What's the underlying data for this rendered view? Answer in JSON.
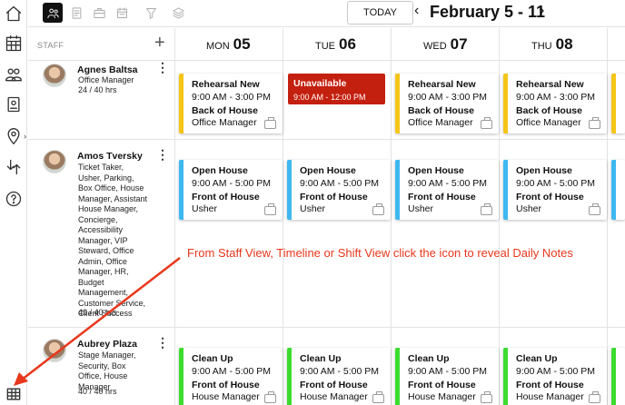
{
  "header": {
    "today_label": "TODAY",
    "date_range": "February 5 - 11",
    "prev_arrow": "‹",
    "next_arrow": "›"
  },
  "grid": {
    "staff_label": "STAFF",
    "add_label": "+",
    "days": [
      {
        "dow": "MON",
        "num": "05"
      },
      {
        "dow": "TUE",
        "num": "06"
      },
      {
        "dow": "WED",
        "num": "07"
      },
      {
        "dow": "THU",
        "num": "08"
      }
    ]
  },
  "staff": [
    {
      "name": "Agnes Baltsa",
      "role": "Office Manager",
      "hours": "24 / 40 hrs"
    },
    {
      "name": "Amos Tversky",
      "role": "Ticket Taker, Usher, Parking, Box Office, House Manager, Assistant House Manager, Concierge, Accessibility Manager, VIP Steward, Office Admin, Office Manager, HR, Budget Management, Customer Service, Client Success",
      "hours": "40 / 40 hrs"
    },
    {
      "name": "Aubrey Plaza",
      "role": "Stage Manager, Security, Box Office, House Manager",
      "hours": "40 / 40 hrs"
    }
  ],
  "shifts": {
    "row1": {
      "title": "Rehearsal New",
      "time": "9:00 AM - 3:00 PM",
      "dept": "Back of House",
      "position": "Office Manager",
      "color": "#f5c518"
    },
    "row1_unavailable": {
      "title": "Unavailable",
      "time": "9:00 AM - 12:00 PM",
      "color": "#c4200f"
    },
    "row2": {
      "title": "Open House",
      "time": "9:00 AM - 5:00 PM",
      "dept": "Front of House",
      "position": "Usher",
      "color": "#3fb8f0"
    },
    "row3": {
      "title": "Clean Up",
      "time": "9:00 AM - 5:00 PM",
      "dept": "Front of House",
      "position": "House Manager",
      "color": "#3ddc2f"
    }
  },
  "annotation": {
    "text": "From Staff View, Timeline or Shift View click the icon to reveal Daily Notes",
    "color": "#e8371c"
  },
  "icons": {
    "rail": [
      "home-icon",
      "calendar-grid-icon",
      "people-icon",
      "badge-icon",
      "location-pin-icon",
      "swap-arrows-icon",
      "help-icon",
      "daily-notes-grid-icon"
    ],
    "views": [
      "staff-view-icon",
      "notes-view-icon",
      "briefcase-view-icon",
      "calendar-view-icon",
      "filter-icon",
      "layers-icon"
    ]
  }
}
